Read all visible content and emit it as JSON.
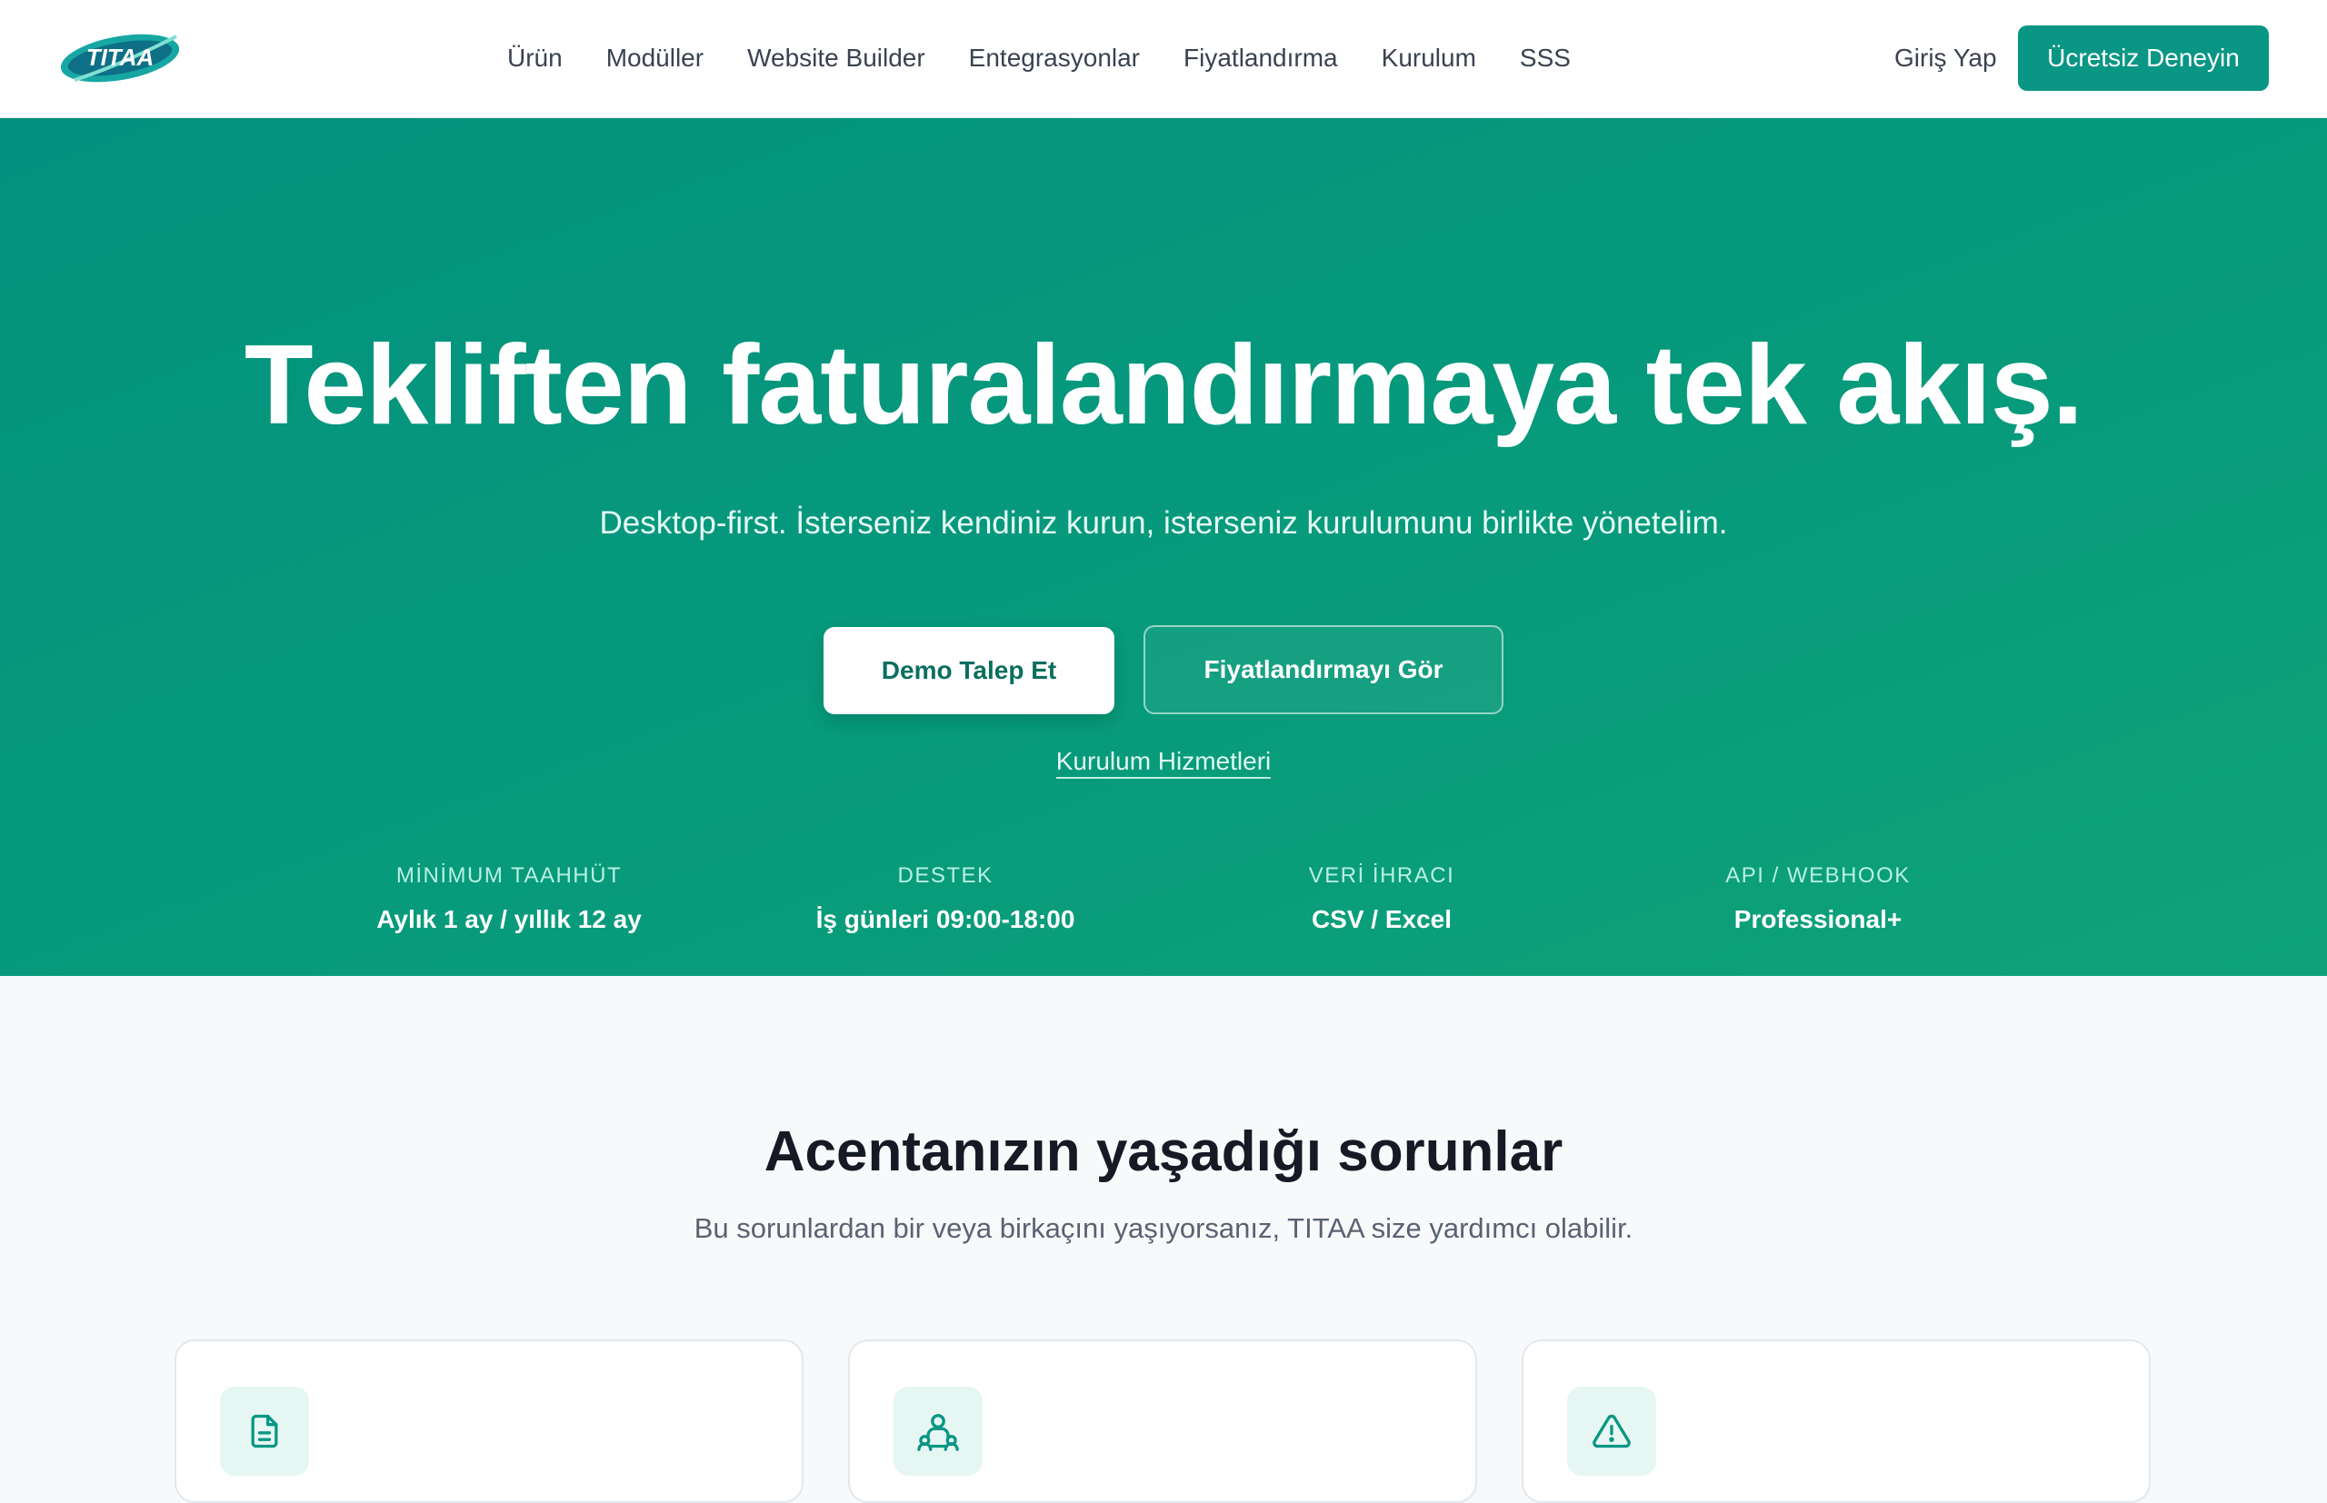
{
  "brand": {
    "logo_text": "TITAA",
    "accent": "#0a9684"
  },
  "nav": {
    "links": [
      "Ürün",
      "Modüller",
      "Website Builder",
      "Entegrasyonlar",
      "Fiyatlandırma",
      "Kurulum",
      "SSS"
    ],
    "login": "Giriş Yap",
    "cta": "Ücretsiz Deneyin"
  },
  "hero": {
    "title": "Tekliften faturalandırmaya tek akış.",
    "subtitle": "Desktop-first. İsterseniz kendiniz kurun, isterseniz kurulumunu birlikte yönetelim.",
    "primary_button": "Demo Talep Et",
    "secondary_button": "Fiyatlandırmayı Gör",
    "link": "Kurulum Hizmetleri",
    "stats": [
      {
        "label": "MİNİMUM TAAHHÜT",
        "value": "Aylık 1 ay / yıllık 12 ay"
      },
      {
        "label": "DESTEK",
        "value": "İş günleri 09:00-18:00"
      },
      {
        "label": "VERİ İHRACI",
        "value": "CSV / Excel"
      },
      {
        "label": "API / WEBHOOK",
        "value": "Professional+"
      }
    ]
  },
  "problems": {
    "title": "Acentanızın yaşadığı sorunlar",
    "subtitle": "Bu sorunlardan bir veya birkaçını yaşıyorsanız, TITAA size yardımcı olabilir.",
    "cards": [
      {
        "icon": "document-icon"
      },
      {
        "icon": "users-icon"
      },
      {
        "icon": "warning-icon"
      }
    ]
  }
}
